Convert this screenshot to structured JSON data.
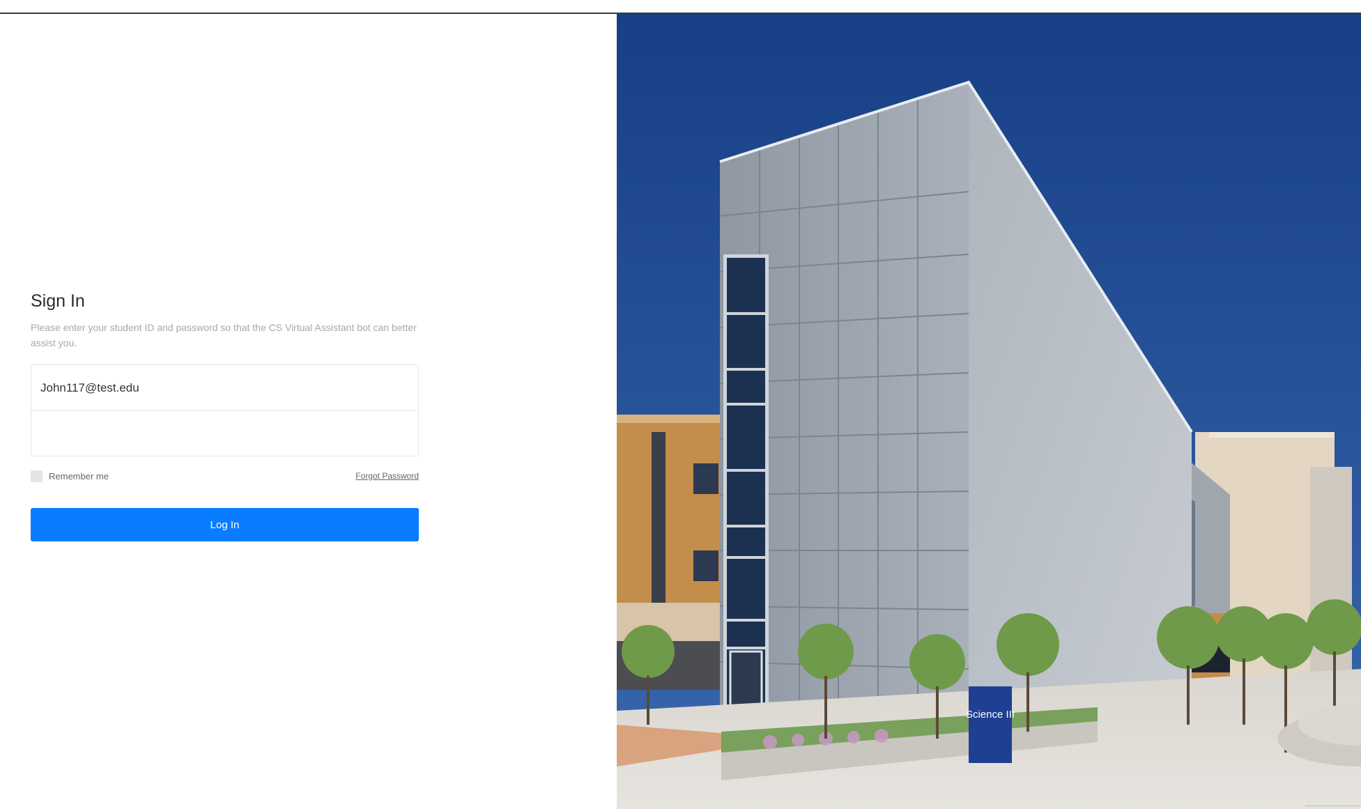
{
  "signin": {
    "title": "Sign In",
    "description": "Please enter your student ID and password so that the CS Virtual Assistant bot can better assist you.",
    "student_id_value": "John117@test.edu",
    "student_id_placeholder": "",
    "password_value": "",
    "password_placeholder": "",
    "remember_label": "Remember me",
    "remember_checked": false,
    "forgot_label": "Forgot Password",
    "login_label": "Log In"
  },
  "hero": {
    "sign_text": "Science III"
  },
  "colors": {
    "primary": "#0a7cff",
    "sky": "#1f4a8f",
    "panel": "#9aa2ac",
    "brick": "#c8934f"
  }
}
